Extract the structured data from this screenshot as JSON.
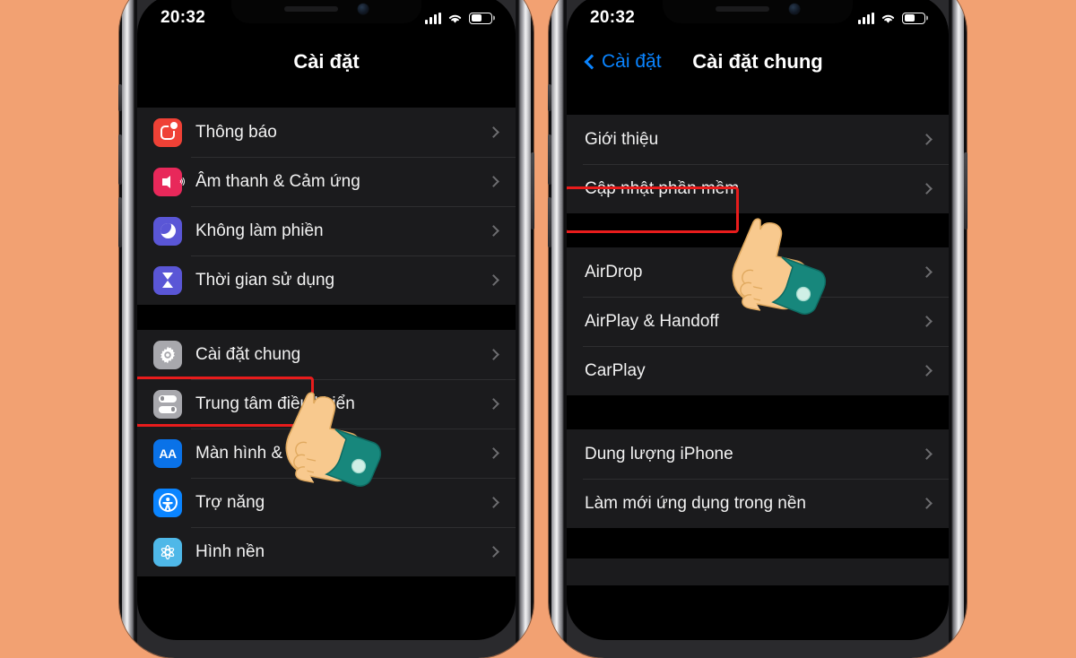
{
  "background_color": "#F2A172",
  "accent_blue": "#0A84FF",
  "highlight_color": "#E81C1C",
  "phones": [
    {
      "id": "phone-settings",
      "status_bar": {
        "time": "20:32",
        "signal_icon": "cellular-bars-icon",
        "wifi_icon": "wifi-icon",
        "battery_icon": "battery-icon",
        "battery_level": 55
      },
      "nav": {
        "title": "Cài đặt",
        "has_back": false,
        "back_label": ""
      },
      "groups": [
        {
          "rows": [
            {
              "label": "Thông báo",
              "icon": "notifications-icon",
              "icon_color": "#EF4136",
              "highlighted": false
            },
            {
              "label": "Âm thanh & Cảm ứng",
              "icon": "sounds-haptics-icon",
              "icon_color": "#E8285A",
              "highlighted": false
            },
            {
              "label": "Không làm phiền",
              "icon": "do-not-disturb-moon-icon",
              "icon_color": "#5A56D6",
              "highlighted": false
            },
            {
              "label": "Thời gian sử dụng",
              "icon": "screen-time-hourglass-icon",
              "icon_color": "#5A56D6",
              "highlighted": false
            }
          ]
        },
        {
          "rows": [
            {
              "label": "Cài đặt chung",
              "icon": "general-gear-icon",
              "icon_color": "#A8A8AD",
              "highlighted": true
            },
            {
              "label": "Trung tâm điều khiển",
              "icon": "control-center-toggles-icon",
              "icon_color": "#A8A8AD",
              "highlighted": false
            },
            {
              "label": "Màn hình & Độ sáng",
              "icon": "display-brightness-aa-icon",
              "icon_color": "#0A72E8",
              "highlighted": false
            },
            {
              "label": "Trợ năng",
              "icon": "accessibility-icon",
              "icon_color": "#0A84FF",
              "highlighted": false
            },
            {
              "label": "Hình nền",
              "icon": "wallpaper-flower-icon",
              "icon_color": "#4FB8E8",
              "highlighted": false
            }
          ]
        }
      ]
    },
    {
      "id": "phone-general",
      "status_bar": {
        "time": "20:32",
        "signal_icon": "cellular-bars-icon",
        "wifi_icon": "wifi-icon",
        "battery_icon": "battery-icon",
        "battery_level": 55
      },
      "nav": {
        "title": "Cài đặt chung",
        "has_back": true,
        "back_label": "Cài đặt"
      },
      "groups": [
        {
          "rows": [
            {
              "label": "Giới thiệu",
              "icon": null,
              "highlighted": false
            },
            {
              "label": "Cập nhật phần mềm",
              "icon": null,
              "highlighted": true
            }
          ]
        },
        {
          "rows": [
            {
              "label": "AirDrop",
              "icon": null,
              "highlighted": false
            },
            {
              "label": "AirPlay & Handoff",
              "icon": null,
              "highlighted": false
            },
            {
              "label": "CarPlay",
              "icon": null,
              "highlighted": false
            }
          ]
        },
        {
          "rows": [
            {
              "label": "Dung lượng iPhone",
              "icon": null,
              "highlighted": false
            },
            {
              "label": "Làm mới ứng dụng trong nền",
              "icon": null,
              "highlighted": false
            }
          ]
        }
      ]
    }
  ],
  "cursors": [
    {
      "name": "pointing-hand-cursor-left",
      "target": "Cài đặt chung"
    },
    {
      "name": "pointing-hand-cursor-right",
      "target": "Cập nhật phần mềm"
    }
  ]
}
